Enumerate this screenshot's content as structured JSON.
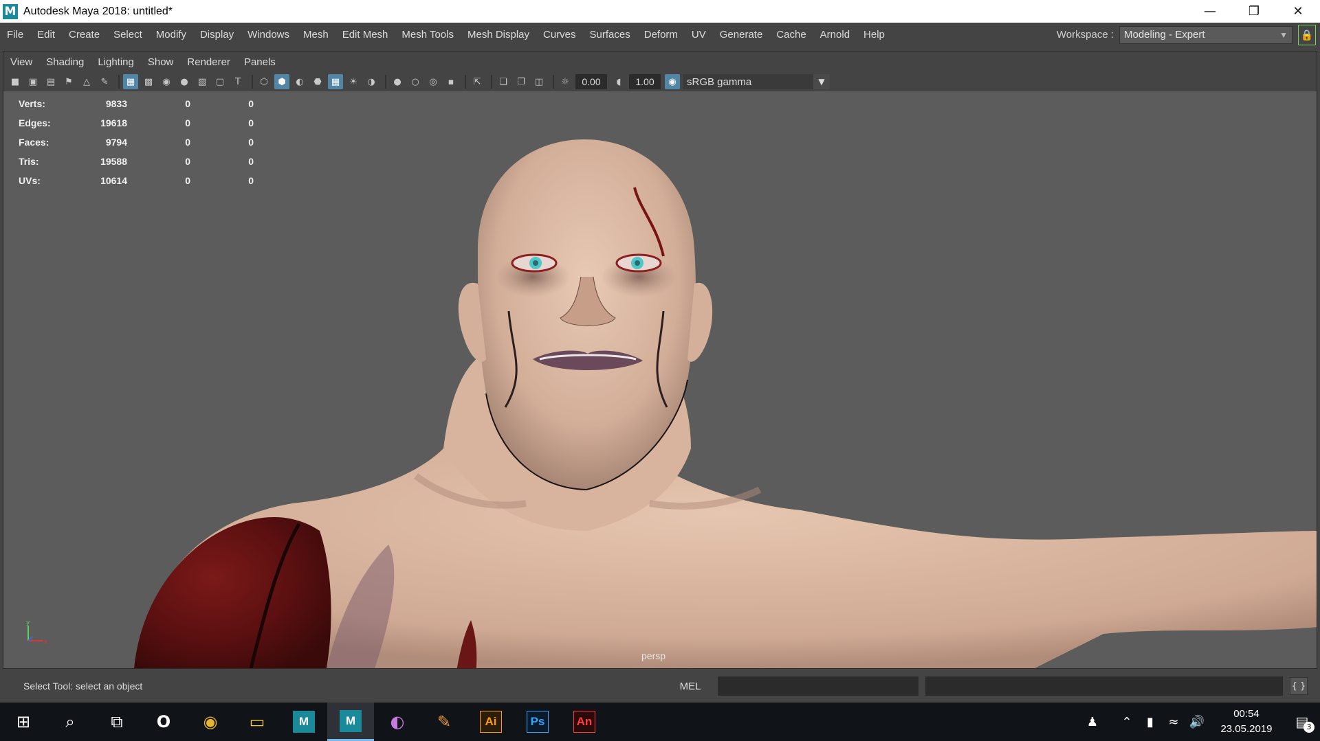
{
  "window": {
    "title": "Autodesk Maya 2018: untitled*",
    "app_icon": "M",
    "controls": [
      "minimize-icon",
      "restore-icon",
      "close-icon"
    ]
  },
  "menubar": {
    "items": [
      "File",
      "Edit",
      "Create",
      "Select",
      "Modify",
      "Display",
      "Windows",
      "Mesh",
      "Edit Mesh",
      "Mesh Tools",
      "Mesh Display",
      "Curves",
      "Surfaces",
      "Deform",
      "UV",
      "Generate",
      "Cache",
      "Arnold",
      "Help"
    ],
    "workspace_label": "Workspace :",
    "workspace_value": "Modeling - Expert"
  },
  "panel": {
    "menu": [
      "View",
      "Shading",
      "Lighting",
      "Show",
      "Renderer",
      "Panels"
    ],
    "toolbar": {
      "exposure": "0.00",
      "gamma": "1.00",
      "color_space": "sRGB gamma"
    }
  },
  "hud": {
    "rows": [
      {
        "label": "Verts:",
        "total": "9833",
        "selected": "0",
        "component": "0"
      },
      {
        "label": "Edges:",
        "total": "19618",
        "selected": "0",
        "component": "0"
      },
      {
        "label": "Faces:",
        "total": "9794",
        "selected": "0",
        "component": "0"
      },
      {
        "label": "Tris:",
        "total": "19588",
        "selected": "0",
        "component": "0"
      },
      {
        "label": "UVs:",
        "total": "10614",
        "selected": "0",
        "component": "0"
      }
    ]
  },
  "viewport": {
    "camera": "persp",
    "axis_y": "y",
    "axis_x": "x"
  },
  "statusbar": {
    "message": "Select Tool: select an object",
    "command_label": "MEL"
  },
  "taskbar": {
    "apps": [
      {
        "name": "windows-start-icon",
        "glyph": "⊞"
      },
      {
        "name": "search-icon",
        "glyph": "⌕"
      },
      {
        "name": "task-view-icon",
        "glyph": "⧉"
      },
      {
        "name": "opera-icon",
        "glyph": "O"
      },
      {
        "name": "chrome-icon",
        "glyph": "◉"
      },
      {
        "name": "file-explorer-icon",
        "glyph": "▭"
      },
      {
        "name": "maya-icon",
        "glyph": "M"
      },
      {
        "name": "maya-active-icon",
        "glyph": "M"
      },
      {
        "name": "color-picker-icon",
        "glyph": "◐"
      },
      {
        "name": "pencil-icon",
        "glyph": "✎"
      },
      {
        "name": "illustrator-icon",
        "glyph": "Ai"
      },
      {
        "name": "photoshop-icon",
        "glyph": "Ps"
      },
      {
        "name": "animate-icon",
        "glyph": "An"
      }
    ],
    "time": "00:54",
    "date": "23.05.2019",
    "notification_count": "3"
  }
}
